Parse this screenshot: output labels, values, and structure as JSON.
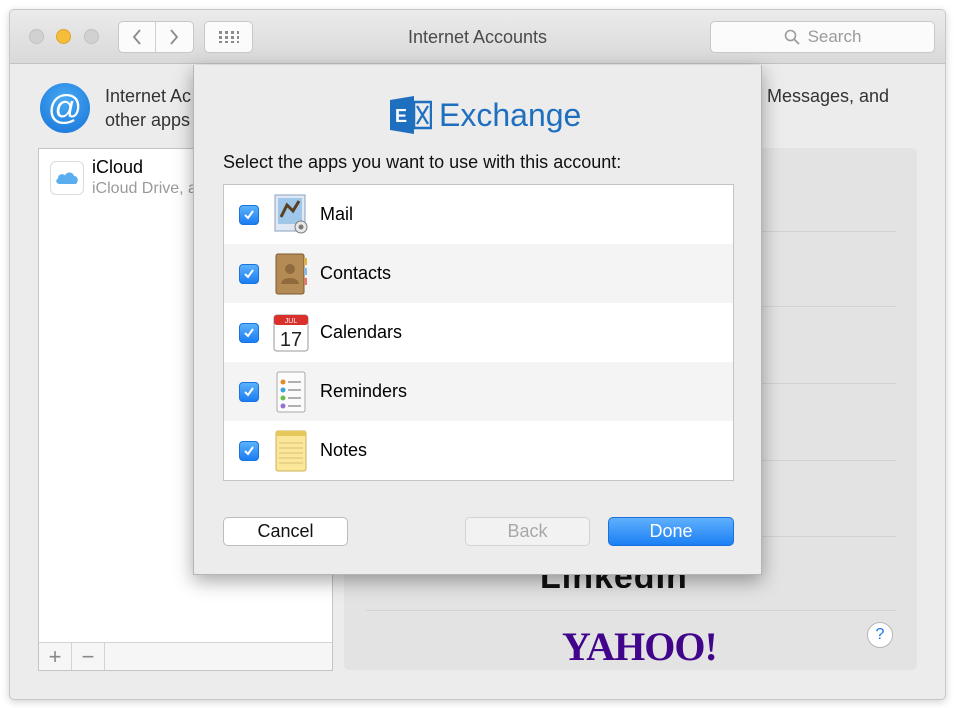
{
  "window": {
    "title": "Internet Accounts",
    "search_placeholder": "Search"
  },
  "header": {
    "text_line1": "Internet Ac",
    "text_line2": "other apps",
    "text_right": "Messages, and"
  },
  "accounts": [
    {
      "name": "iCloud",
      "detail": "iCloud Drive, a",
      "icon": "icloud-icon"
    }
  ],
  "account_list_footer": {
    "add_label": "+",
    "remove_label": "−"
  },
  "providers": [
    {
      "name": "LinkedIn"
    },
    {
      "name": "YAHOO!",
      "color": "#41058b"
    }
  ],
  "help_label": "?",
  "sheet": {
    "logo_text": "Exchange",
    "logo_color": "#1e6fc0",
    "prompt": "Select the apps you want to use with this account:",
    "apps": [
      {
        "label": "Mail",
        "checked": true,
        "icon": "mail-icon"
      },
      {
        "label": "Contacts",
        "checked": true,
        "icon": "contacts-icon"
      },
      {
        "label": "Calendars",
        "checked": true,
        "icon": "calendar-icon",
        "icon_month": "JUL",
        "icon_day": "17"
      },
      {
        "label": "Reminders",
        "checked": true,
        "icon": "reminders-icon"
      },
      {
        "label": "Notes",
        "checked": true,
        "icon": "notes-icon"
      }
    ],
    "buttons": {
      "cancel": "Cancel",
      "back": "Back",
      "done": "Done"
    },
    "accent_color": "#1b7ff4"
  }
}
